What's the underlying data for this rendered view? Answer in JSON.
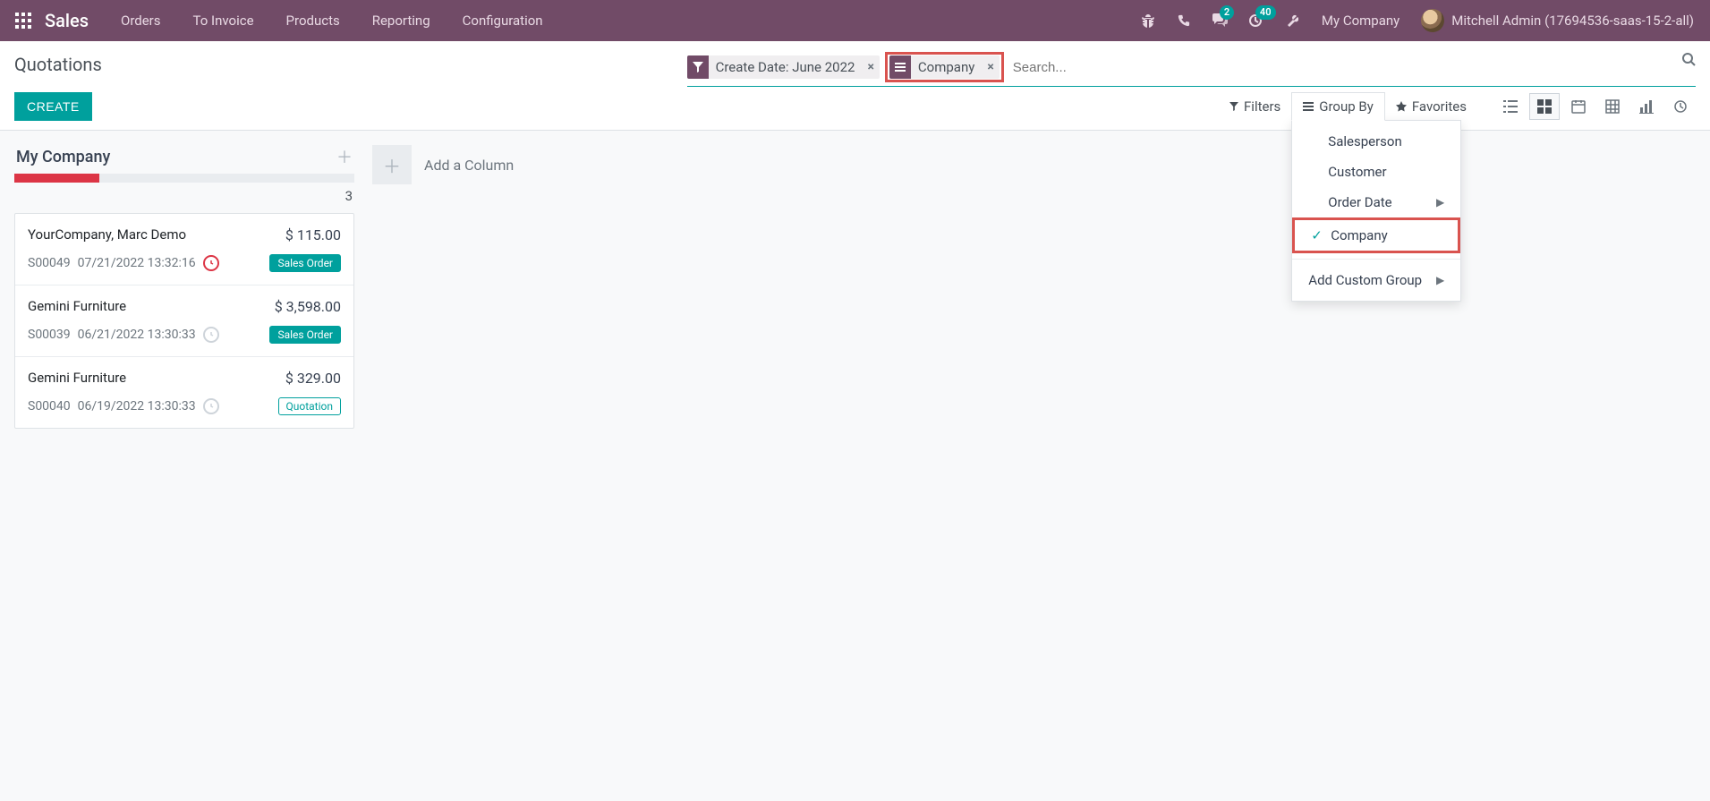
{
  "nav": {
    "brand": "Sales",
    "items": [
      "Orders",
      "To Invoice",
      "Products",
      "Reporting",
      "Configuration"
    ],
    "chat_badge": "2",
    "activity_badge": "40",
    "company": "My Company",
    "user": "Mitchell Admin (17694536-saas-15-2-all)"
  },
  "breadcrumb": "Quotations",
  "create_label": "CREATE",
  "search": {
    "placeholder": "Search...",
    "facets": [
      {
        "type": "filter",
        "label": "Create Date: June 2022"
      },
      {
        "type": "group",
        "label": "Company"
      }
    ]
  },
  "toolbar": {
    "filters": "Filters",
    "groupby": "Group By",
    "favorites": "Favorites"
  },
  "groupby_menu": {
    "items": [
      "Salesperson",
      "Customer",
      "Order Date",
      "Company"
    ],
    "selected": "Company",
    "add_custom": "Add Custom Group"
  },
  "kanban": {
    "column_title": "My Company",
    "count": "3",
    "progress_pct": 25,
    "add_column": "Add a Column",
    "cards": [
      {
        "customer": "YourCompany, Marc Demo",
        "amount": "$ 115.00",
        "ref": "S00049",
        "datetime": "07/21/2022 13:32:16",
        "clock": "red",
        "status_label": "Sales Order",
        "status_kind": "so"
      },
      {
        "customer": "Gemini Furniture",
        "amount": "$ 3,598.00",
        "ref": "S00039",
        "datetime": "06/21/2022 13:30:33",
        "clock": "grey",
        "status_label": "Sales Order",
        "status_kind": "so"
      },
      {
        "customer": "Gemini Furniture",
        "amount": "$ 329.00",
        "ref": "S00040",
        "datetime": "06/19/2022 13:30:33",
        "clock": "grey",
        "status_label": "Quotation",
        "status_kind": "qt"
      }
    ]
  }
}
